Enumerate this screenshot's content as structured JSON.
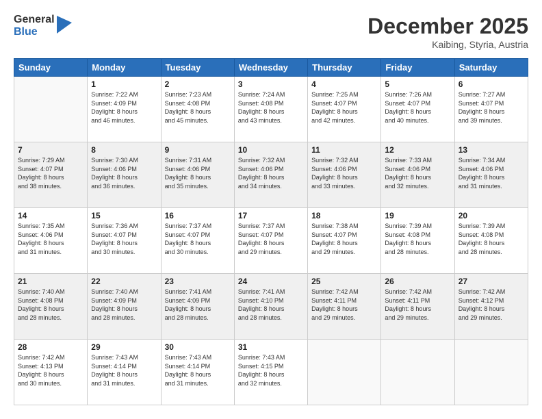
{
  "logo": {
    "general": "General",
    "blue": "Blue"
  },
  "header": {
    "month": "December 2025",
    "location": "Kaibing, Styria, Austria"
  },
  "weekdays": [
    "Sunday",
    "Monday",
    "Tuesday",
    "Wednesday",
    "Thursday",
    "Friday",
    "Saturday"
  ],
  "weeks": [
    [
      {
        "day": "",
        "info": ""
      },
      {
        "day": "1",
        "info": "Sunrise: 7:22 AM\nSunset: 4:09 PM\nDaylight: 8 hours\nand 46 minutes."
      },
      {
        "day": "2",
        "info": "Sunrise: 7:23 AM\nSunset: 4:08 PM\nDaylight: 8 hours\nand 45 minutes."
      },
      {
        "day": "3",
        "info": "Sunrise: 7:24 AM\nSunset: 4:08 PM\nDaylight: 8 hours\nand 43 minutes."
      },
      {
        "day": "4",
        "info": "Sunrise: 7:25 AM\nSunset: 4:07 PM\nDaylight: 8 hours\nand 42 minutes."
      },
      {
        "day": "5",
        "info": "Sunrise: 7:26 AM\nSunset: 4:07 PM\nDaylight: 8 hours\nand 40 minutes."
      },
      {
        "day": "6",
        "info": "Sunrise: 7:27 AM\nSunset: 4:07 PM\nDaylight: 8 hours\nand 39 minutes."
      }
    ],
    [
      {
        "day": "7",
        "info": "Sunrise: 7:29 AM\nSunset: 4:07 PM\nDaylight: 8 hours\nand 38 minutes."
      },
      {
        "day": "8",
        "info": "Sunrise: 7:30 AM\nSunset: 4:06 PM\nDaylight: 8 hours\nand 36 minutes."
      },
      {
        "day": "9",
        "info": "Sunrise: 7:31 AM\nSunset: 4:06 PM\nDaylight: 8 hours\nand 35 minutes."
      },
      {
        "day": "10",
        "info": "Sunrise: 7:32 AM\nSunset: 4:06 PM\nDaylight: 8 hours\nand 34 minutes."
      },
      {
        "day": "11",
        "info": "Sunrise: 7:32 AM\nSunset: 4:06 PM\nDaylight: 8 hours\nand 33 minutes."
      },
      {
        "day": "12",
        "info": "Sunrise: 7:33 AM\nSunset: 4:06 PM\nDaylight: 8 hours\nand 32 minutes."
      },
      {
        "day": "13",
        "info": "Sunrise: 7:34 AM\nSunset: 4:06 PM\nDaylight: 8 hours\nand 31 minutes."
      }
    ],
    [
      {
        "day": "14",
        "info": "Sunrise: 7:35 AM\nSunset: 4:06 PM\nDaylight: 8 hours\nand 31 minutes."
      },
      {
        "day": "15",
        "info": "Sunrise: 7:36 AM\nSunset: 4:07 PM\nDaylight: 8 hours\nand 30 minutes."
      },
      {
        "day": "16",
        "info": "Sunrise: 7:37 AM\nSunset: 4:07 PM\nDaylight: 8 hours\nand 30 minutes."
      },
      {
        "day": "17",
        "info": "Sunrise: 7:37 AM\nSunset: 4:07 PM\nDaylight: 8 hours\nand 29 minutes."
      },
      {
        "day": "18",
        "info": "Sunrise: 7:38 AM\nSunset: 4:07 PM\nDaylight: 8 hours\nand 29 minutes."
      },
      {
        "day": "19",
        "info": "Sunrise: 7:39 AM\nSunset: 4:08 PM\nDaylight: 8 hours\nand 28 minutes."
      },
      {
        "day": "20",
        "info": "Sunrise: 7:39 AM\nSunset: 4:08 PM\nDaylight: 8 hours\nand 28 minutes."
      }
    ],
    [
      {
        "day": "21",
        "info": "Sunrise: 7:40 AM\nSunset: 4:08 PM\nDaylight: 8 hours\nand 28 minutes."
      },
      {
        "day": "22",
        "info": "Sunrise: 7:40 AM\nSunset: 4:09 PM\nDaylight: 8 hours\nand 28 minutes."
      },
      {
        "day": "23",
        "info": "Sunrise: 7:41 AM\nSunset: 4:09 PM\nDaylight: 8 hours\nand 28 minutes."
      },
      {
        "day": "24",
        "info": "Sunrise: 7:41 AM\nSunset: 4:10 PM\nDaylight: 8 hours\nand 28 minutes."
      },
      {
        "day": "25",
        "info": "Sunrise: 7:42 AM\nSunset: 4:11 PM\nDaylight: 8 hours\nand 29 minutes."
      },
      {
        "day": "26",
        "info": "Sunrise: 7:42 AM\nSunset: 4:11 PM\nDaylight: 8 hours\nand 29 minutes."
      },
      {
        "day": "27",
        "info": "Sunrise: 7:42 AM\nSunset: 4:12 PM\nDaylight: 8 hours\nand 29 minutes."
      }
    ],
    [
      {
        "day": "28",
        "info": "Sunrise: 7:42 AM\nSunset: 4:13 PM\nDaylight: 8 hours\nand 30 minutes."
      },
      {
        "day": "29",
        "info": "Sunrise: 7:43 AM\nSunset: 4:14 PM\nDaylight: 8 hours\nand 31 minutes."
      },
      {
        "day": "30",
        "info": "Sunrise: 7:43 AM\nSunset: 4:14 PM\nDaylight: 8 hours\nand 31 minutes."
      },
      {
        "day": "31",
        "info": "Sunrise: 7:43 AM\nSunset: 4:15 PM\nDaylight: 8 hours\nand 32 minutes."
      },
      {
        "day": "",
        "info": ""
      },
      {
        "day": "",
        "info": ""
      },
      {
        "day": "",
        "info": ""
      }
    ]
  ]
}
